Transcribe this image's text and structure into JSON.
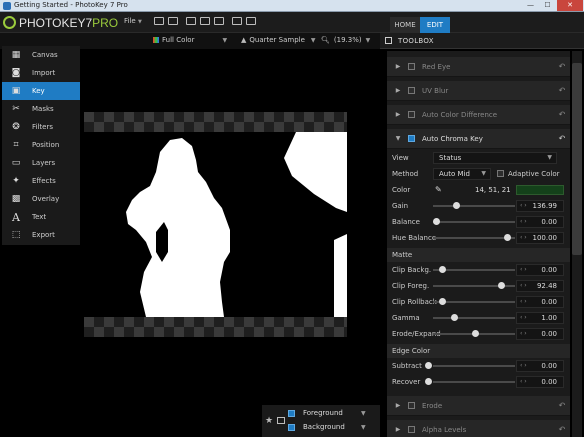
{
  "window": {
    "title": "Getting Started - PhotoKey 7 Pro",
    "minimize": "—",
    "maximize": "☐",
    "close": "✕"
  },
  "header": {
    "logo_main": "PHOTOKEY7",
    "logo_pro": "PRO",
    "file_menu": "File",
    "tabs": [
      {
        "label": "HOME"
      },
      {
        "label": "EDIT"
      }
    ]
  },
  "viewer": {
    "channel": "Full Color",
    "sample": "Quarter Sample",
    "zoom": "(19.3%)"
  },
  "toolbox": {
    "title": "TOOLBOX"
  },
  "nav": [
    {
      "label": "Canvas",
      "icon": "canvas-icon"
    },
    {
      "label": "Import",
      "icon": "camera-icon"
    },
    {
      "label": "Key",
      "icon": "key-icon",
      "active": true
    },
    {
      "label": "Masks",
      "icon": "scissors-icon"
    },
    {
      "label": "Filters",
      "icon": "filters-icon"
    },
    {
      "label": "Position",
      "icon": "crop-icon"
    },
    {
      "label": "Layers",
      "icon": "layers-icon"
    },
    {
      "label": "Effects",
      "icon": "wand-icon"
    },
    {
      "label": "Overlay",
      "icon": "grid-icon"
    },
    {
      "label": "Text",
      "icon": "text-icon"
    },
    {
      "label": "Export",
      "icon": "export-icon"
    }
  ],
  "sections": {
    "red_eye": "Red Eye",
    "uv_blur": "UV Blur",
    "auto_color_diff": "Auto Color Difference",
    "auto_chroma_key": "Auto Chroma Key",
    "erode": "Erode",
    "alpha_levels": "Alpha Levels"
  },
  "chroma": {
    "view_label": "View",
    "view_value": "Status",
    "method_label": "Method",
    "method_value": "Auto Mid",
    "adaptive_color": "Adaptive Color",
    "color_label": "Color",
    "color_value": "14, 51, 21",
    "key_color": "#14411a",
    "gain_label": "Gain",
    "gain_value": "136.99",
    "balance_label": "Balance",
    "balance_value": "0.00",
    "hue_balance_label": "Hue Balance",
    "hue_balance_value": "100.00",
    "matte_header": "Matte",
    "clip_back_label": "Clip Backg.",
    "clip_back_value": "0.00",
    "clip_fore_label": "Clip Foreg.",
    "clip_fore_value": "92.48",
    "clip_rollback_label": "Clip Rollback",
    "clip_rollback_value": "0.00",
    "gamma_label": "Gamma",
    "gamma_value": "1.00",
    "erode_expand_label": "Erode/Expand",
    "erode_expand_value": "0.00",
    "edge_color_header": "Edge Color",
    "subtract_label": "Subtract",
    "subtract_value": "0.00",
    "recover_label": "Recover",
    "recover_value": "0.00"
  },
  "layers": {
    "foreground": "Foreground",
    "background": "Background"
  }
}
